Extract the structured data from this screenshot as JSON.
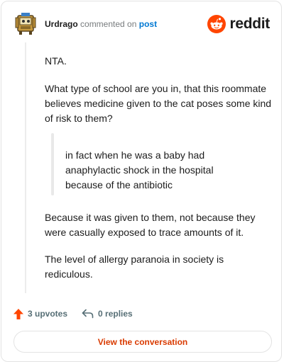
{
  "header": {
    "username": "Urdrago",
    "action_text": "commented on",
    "post_link": "post",
    "brand_name": "reddit"
  },
  "comment": {
    "paragraph_1": "NTA.",
    "paragraph_2": "What type of school are you in, that this roommate believes medicine given to the cat poses some kind of risk to them?",
    "quote_line_1": "in fact when he was a baby had",
    "quote_line_2": "anaphylactic shock in the hospital",
    "quote_line_3": "because of the antibiotic",
    "paragraph_3": "Because it was given to them, not because they were casually exposed to trace amounts of it.",
    "paragraph_4": "The level of allergy paranoia in society is rediculous."
  },
  "footer": {
    "upvotes_label": "3 upvotes",
    "replies_label": "0 replies",
    "view_conversation_label": "View the conversation"
  },
  "colors": {
    "reddit_orange": "#ff4500",
    "link_blue": "#0079d3",
    "button_text": "#d93a00",
    "muted": "#787c7e"
  },
  "icons": {
    "avatar": "snoo-avatar-image",
    "brand": "reddit-logo-icon",
    "upvote": "upvote-arrow-icon",
    "reply": "reply-arrow-icon"
  }
}
